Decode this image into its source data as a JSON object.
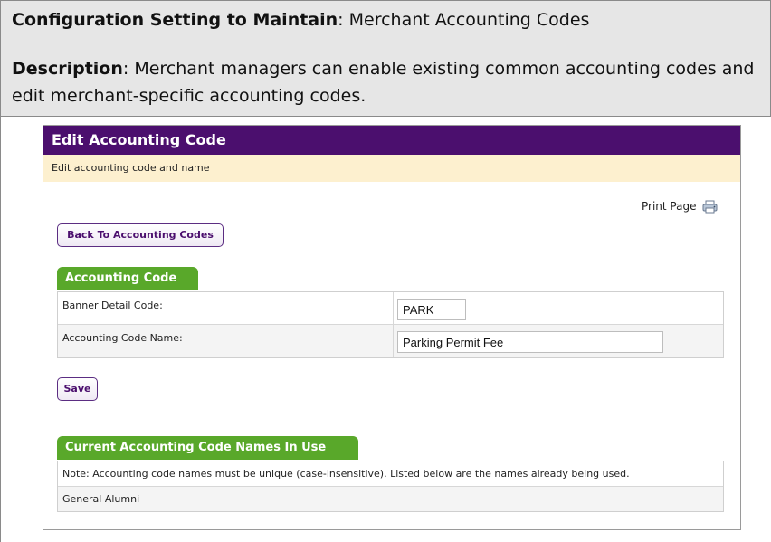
{
  "config": {
    "setting_label": "Configuration Setting to Maintain",
    "setting_value": ": Merchant Accounting Codes",
    "description_label": "Description",
    "description_text": ": Merchant managers can enable existing common accounting codes and edit merchant-specific accounting codes."
  },
  "panel": {
    "title": "Edit Accounting Code",
    "subtitle": "Edit accounting code and name",
    "print_label": "Print Page",
    "print_icon": "printer-icon",
    "back_button": "Back To Accounting Codes",
    "save_button": "Save"
  },
  "accounting_code": {
    "section_title": "Accounting Code",
    "rows": [
      {
        "label": "Banner Detail Code:",
        "value": "PARK"
      },
      {
        "label": "Accounting Code Name:",
        "value": "Parking Permit Fee"
      }
    ]
  },
  "names_in_use": {
    "section_title": "Current Accounting Code Names In Use",
    "note": "Note: Accounting code names must be unique (case-insensitive). Listed below are the names already being used.",
    "items": [
      "General Alumni"
    ]
  },
  "colors": {
    "title_bar": "#4b0f6e",
    "subtitle_bar": "#fdf0cf",
    "section_tab": "#59a82a",
    "config_bg": "#e6e6e6"
  }
}
